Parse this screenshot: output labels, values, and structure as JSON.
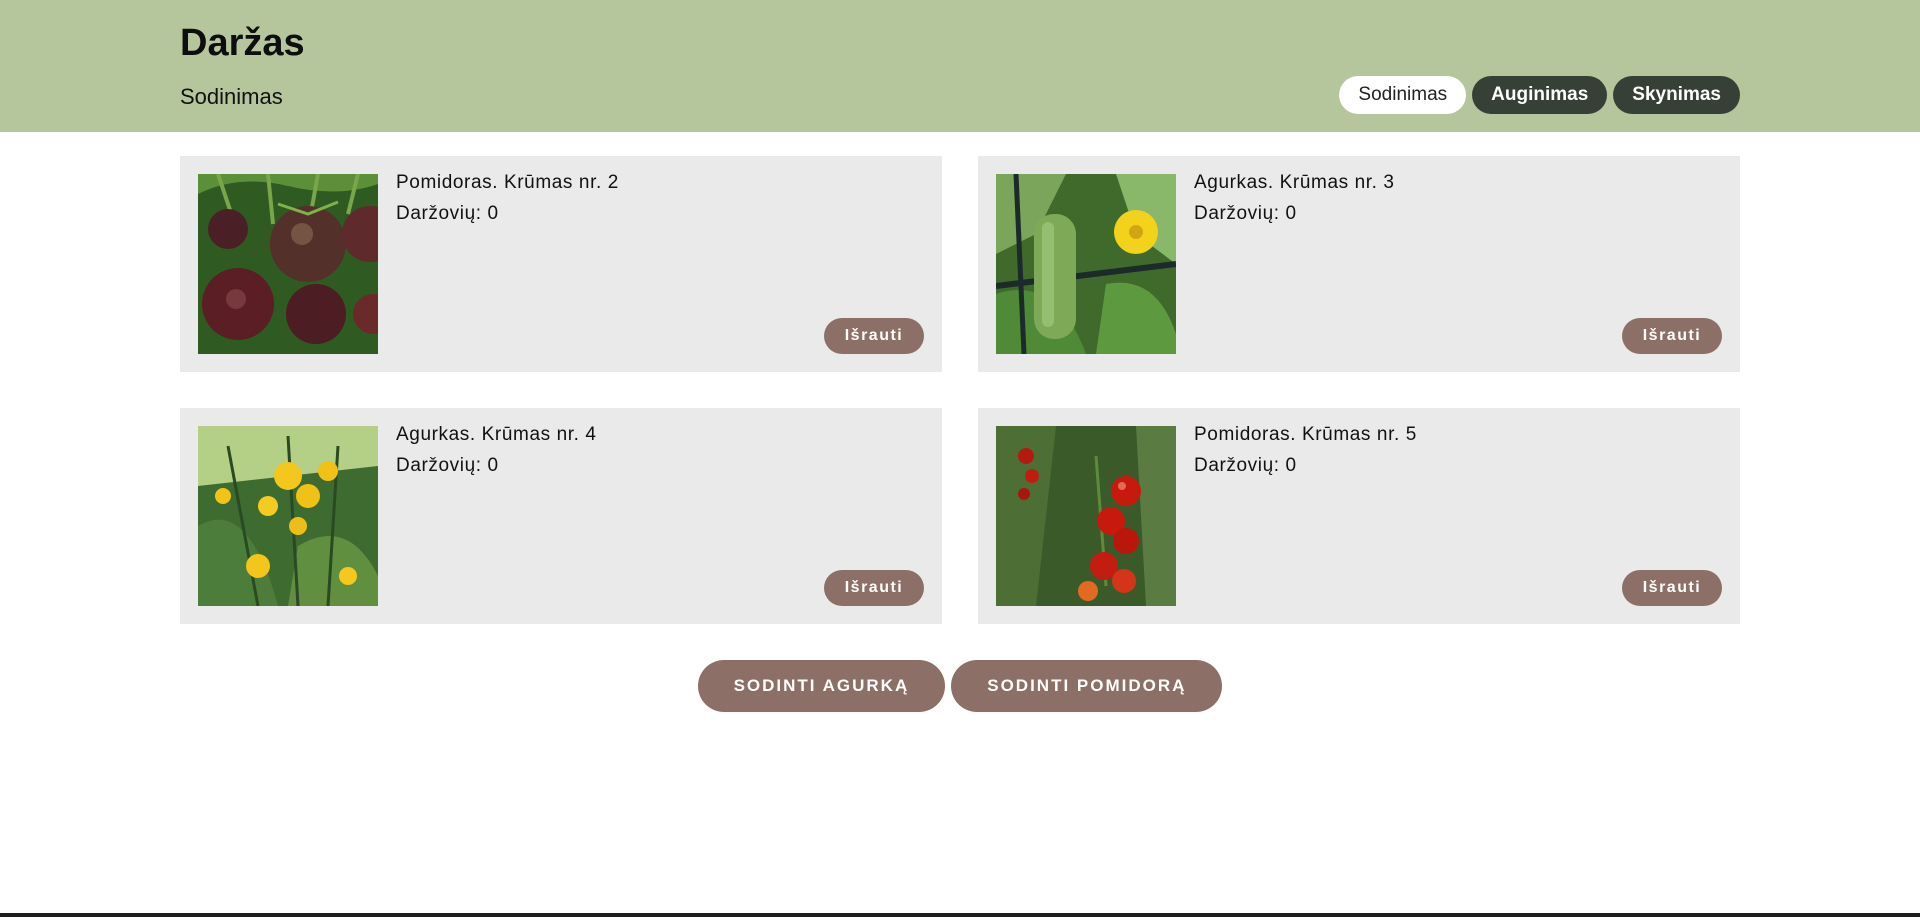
{
  "header": {
    "brand": "Daržas",
    "subtitle": "Sodinimas",
    "nav": [
      {
        "label": "Sodinimas",
        "active": true
      },
      {
        "label": "Auginimas",
        "active": false
      },
      {
        "label": "Skynimas",
        "active": false
      }
    ]
  },
  "cards": [
    {
      "title": "Pomidoras. Krūmas nr. 2",
      "count_label": "Daržovių: 0",
      "button": "Išrauti",
      "image": "dark-tomato-photo"
    },
    {
      "title": "Agurkas. Krūmas nr. 3",
      "count_label": "Daržovių: 0",
      "button": "Išrauti",
      "image": "cucumber-photo"
    },
    {
      "title": "Agurkas. Krūmas nr. 4",
      "count_label": "Daržovių: 0",
      "button": "Išrauti",
      "image": "cucumber-flowers-photo"
    },
    {
      "title": "Pomidoras. Krūmas nr. 5",
      "count_label": "Daržovių: 0",
      "button": "Išrauti",
      "image": "cherry-tomato-photo"
    }
  ],
  "actions": {
    "plant_cucumber": "SODINTI AGURKĄ",
    "plant_tomato": "SODINTI POMIDORĄ"
  },
  "colors": {
    "header_bg": "#b5c59c",
    "nav_dark": "#374037",
    "card_bg": "#eaeaea",
    "button_brown": "#8c6f66"
  }
}
